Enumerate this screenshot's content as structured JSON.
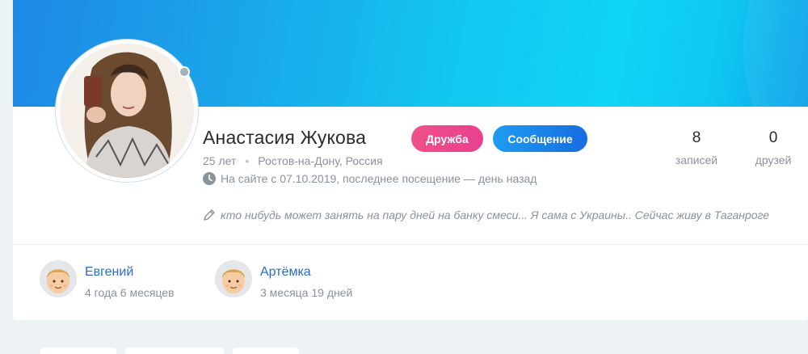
{
  "profile": {
    "name": "Анастасия Жукова",
    "age": "25 лет",
    "location": "Ростов-на-Дону, Россия",
    "since": "На сайте с 07.10.2019, последнее посещение — день назад",
    "status": "кто нибудь может занять на пару дней на банку смеси... Я сама с Украины.. Сейчас живу в Таганроге"
  },
  "buttons": {
    "friend": "Дружба",
    "message": "Сообщение"
  },
  "stats": {
    "posts": {
      "value": "8",
      "label": "записей"
    },
    "friends": {
      "value": "0",
      "label": "друзей"
    }
  },
  "friends_list": [
    {
      "name": "Евгений",
      "duration": "4 года 6 месяцев"
    },
    {
      "name": "Артёмка",
      "duration": "3 месяца 19 дней"
    }
  ],
  "colors": {
    "friend_button": "#e8408f",
    "message_button": "#176ce0",
    "link": "#2b6cc4"
  }
}
